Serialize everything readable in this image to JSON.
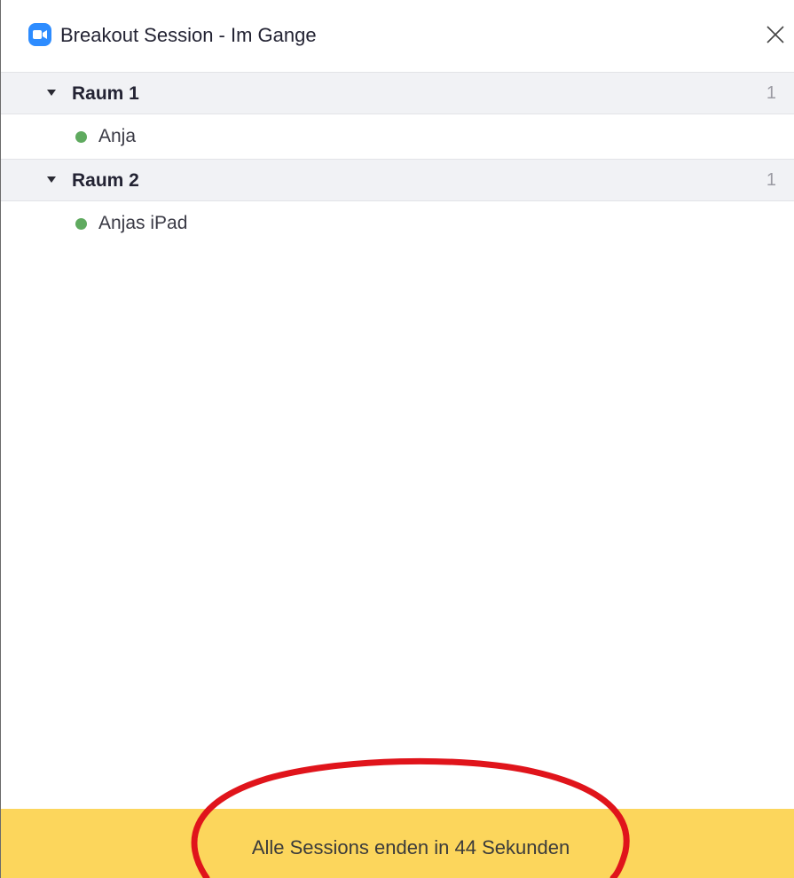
{
  "window": {
    "title": "Breakout Session - Im Gange",
    "icon": "zoom-video-icon",
    "close_icon": "close-icon"
  },
  "rooms": [
    {
      "name": "Raum 1",
      "count": "1",
      "participants": [
        {
          "name": "Anja",
          "status": "online"
        }
      ]
    },
    {
      "name": "Raum 2",
      "count": "1",
      "participants": [
        {
          "name": "Anjas iPad",
          "status": "online"
        }
      ]
    }
  ],
  "footer": {
    "message": "Alle Sessions enden in 44 Sekunden"
  },
  "colors": {
    "accent": "#2d8cff",
    "status_online": "#5faa5f",
    "footer_bg": "#fcd65c",
    "annotation": "#e0141b"
  }
}
